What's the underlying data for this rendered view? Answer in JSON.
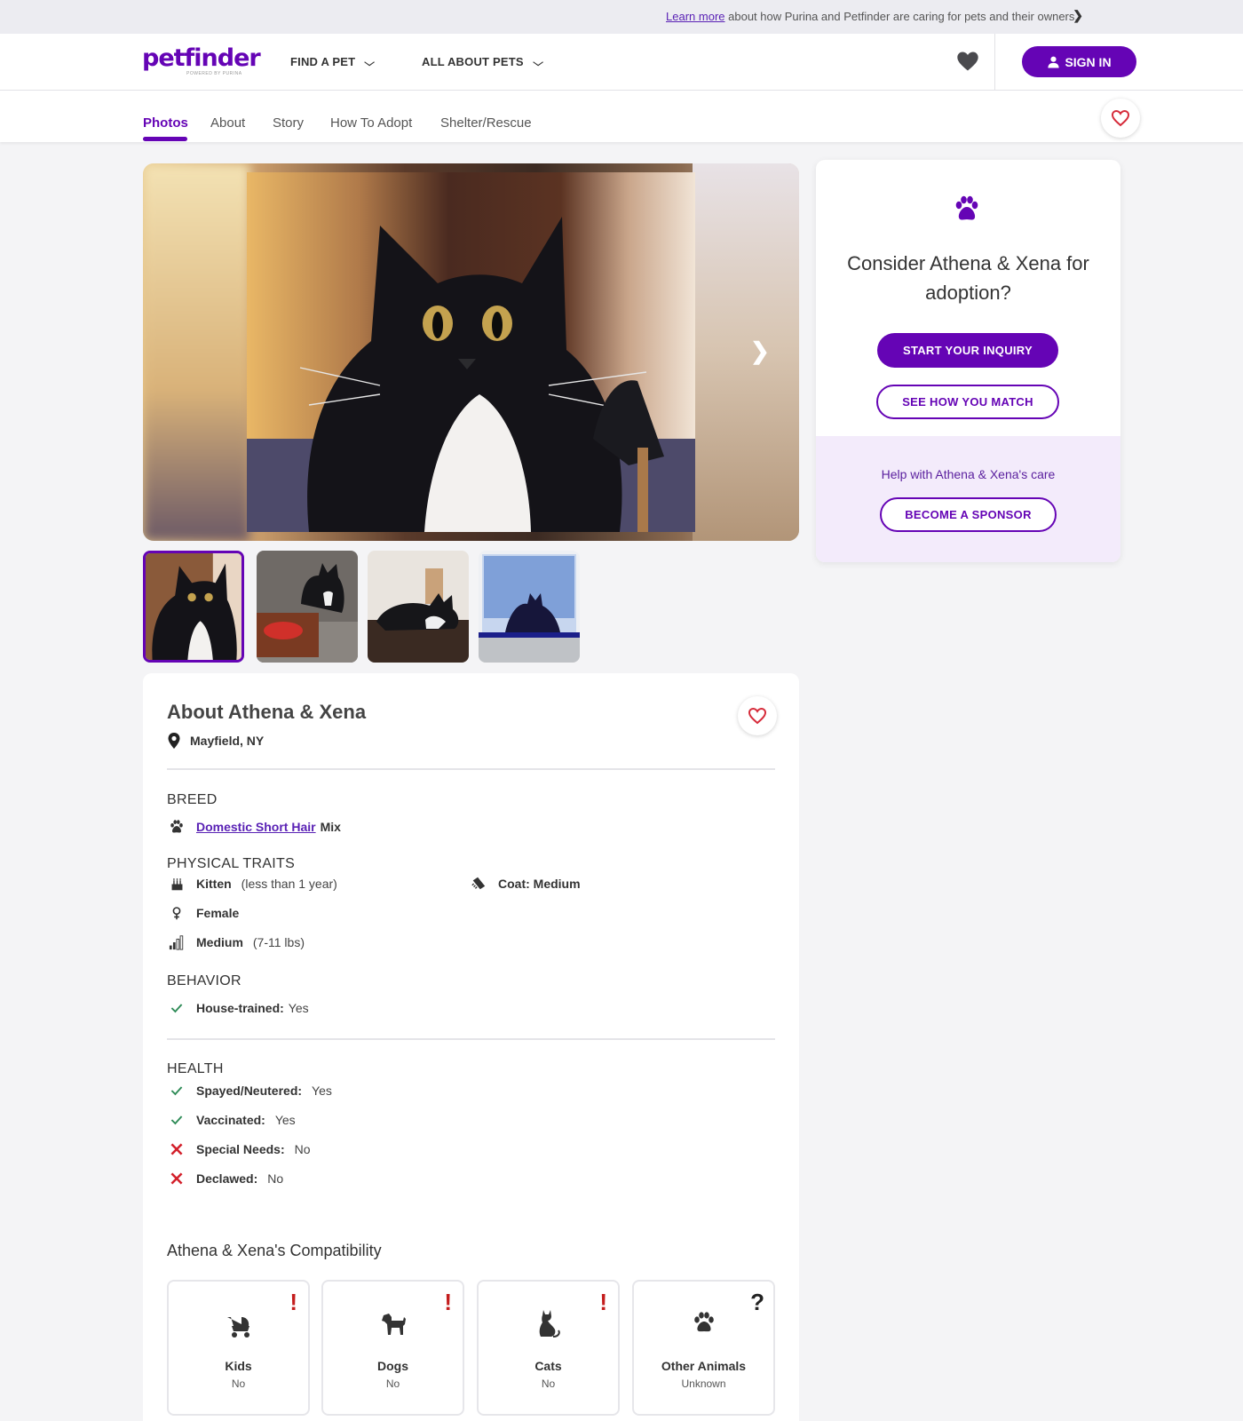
{
  "banner": {
    "link": "Learn more",
    "text": "about how Purina and Petfinder are caring for pets and their owners."
  },
  "header": {
    "logo": "petfinder",
    "logo_sub": "POWERED BY PURINA",
    "nav": [
      "FIND A PET",
      "ALL ABOUT PETS"
    ],
    "signin": "SIGN IN"
  },
  "subnav": {
    "tabs": [
      "Photos",
      "About",
      "Story",
      "How To Adopt",
      "Shelter/Rescue"
    ],
    "active": "Photos"
  },
  "gallery": {
    "thumbnail_count": 4,
    "selected_index": 0
  },
  "card": {
    "title": "Consider Athena & Xena for adoption?",
    "inquiry": "START YOUR INQUIRY",
    "match": "SEE HOW YOU MATCH",
    "help_text": "Help with Athena & Xena's care",
    "sponsor": "BECOME A SPONSOR"
  },
  "about": {
    "title": "About Athena & Xena",
    "location": "Mayfield, NY",
    "breed_title": "BREED",
    "breed_link": "Domestic Short Hair",
    "breed_suffix": "Mix",
    "traits_title": "PHYSICAL TRAITS",
    "age_label": "Kitten",
    "age_detail": "(less than 1 year)",
    "coat": "Coat: Medium",
    "sex": "Female",
    "size_label": "Medium",
    "size_detail": "(7-11 lbs)",
    "behavior_title": "BEHAVIOR",
    "house_label": "House-trained:",
    "house_value": "Yes",
    "health_title": "HEALTH",
    "health": [
      {
        "label": "Spayed/Neutered:",
        "value": "Yes",
        "ok": true
      },
      {
        "label": "Vaccinated:",
        "value": "Yes",
        "ok": true
      },
      {
        "label": "Special Needs:",
        "value": "No",
        "ok": false
      },
      {
        "label": "Declawed:",
        "value": "No",
        "ok": false
      }
    ]
  },
  "compatibility": {
    "title": "Athena & Xena's Compatibility",
    "items": [
      {
        "name": "Kids",
        "status": "No",
        "flag": "!"
      },
      {
        "name": "Dogs",
        "status": "No",
        "flag": "!"
      },
      {
        "name": "Cats",
        "status": "No",
        "flag": "!"
      },
      {
        "name": "Other Animals",
        "status": "Unknown",
        "flag": "?"
      }
    ]
  },
  "colors": {
    "brand_purple": "#6504b5",
    "warn_red": "#c41d1d",
    "ok_green": "#2e8b57",
    "sponsor_bg": "#f3ebfb"
  }
}
